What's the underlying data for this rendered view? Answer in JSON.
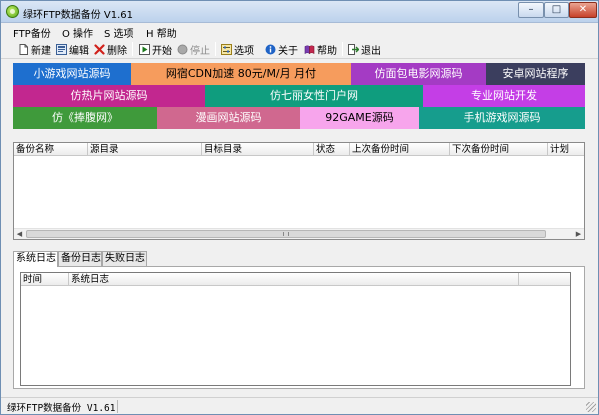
{
  "window": {
    "title": "绿环FTP数据备份 V1.61",
    "controls": {
      "minimize": "–",
      "maximize": "□",
      "close": "✕"
    }
  },
  "menu": {
    "items": [
      {
        "label": "FTP备份"
      },
      {
        "label": "O 操作"
      },
      {
        "label": "S 选项"
      },
      {
        "label": "H 帮助"
      }
    ]
  },
  "toolbar": {
    "new_label": "新建",
    "edit_label": "编辑",
    "delete_label": "删除",
    "start_label": "开始",
    "stop_label": "停止",
    "options_label": "选项",
    "about_label": "关于",
    "help_label": "帮助",
    "exit_label": "退出"
  },
  "ads": {
    "row1": [
      "小游戏网站源码",
      "网宿CDN加速 80元/M/月 月付",
      "仿面包电影网源码",
      "安卓网站程序"
    ],
    "row2": [
      "仿热片网站源码",
      "仿七丽女性门户网",
      "专业网站开发"
    ],
    "row3": [
      "仿《捧腹网》",
      "漫画网站源码",
      "92GAME源码",
      "手机游戏网源码"
    ]
  },
  "colors": {
    "ad_blue": "#1e6fcf",
    "ad_orange": "#f69c5d",
    "ad_purple": "#a43bc4",
    "ad_darkslate": "#3b3e5e",
    "ad_magenta": "#c2278f",
    "ad_teal": "#0f9d7e",
    "ad_violet": "#c43ee6",
    "ad_green": "#3f9a3b",
    "ad_rose": "#d0688f",
    "ad_pink": "#f7a5ec",
    "ad_teal2": "#169d8d"
  },
  "backup_list": {
    "columns": [
      "备份名称",
      "源目录",
      "目标目录",
      "状态",
      "上次备份时间",
      "下次备份时间",
      "计划"
    ]
  },
  "log_tabs": [
    "系统日志",
    "备份日志",
    "失败日志"
  ],
  "log_list": {
    "columns": [
      "时间",
      "系统日志"
    ]
  },
  "status": {
    "text": "绿环FTP数据备份 V1.61"
  }
}
